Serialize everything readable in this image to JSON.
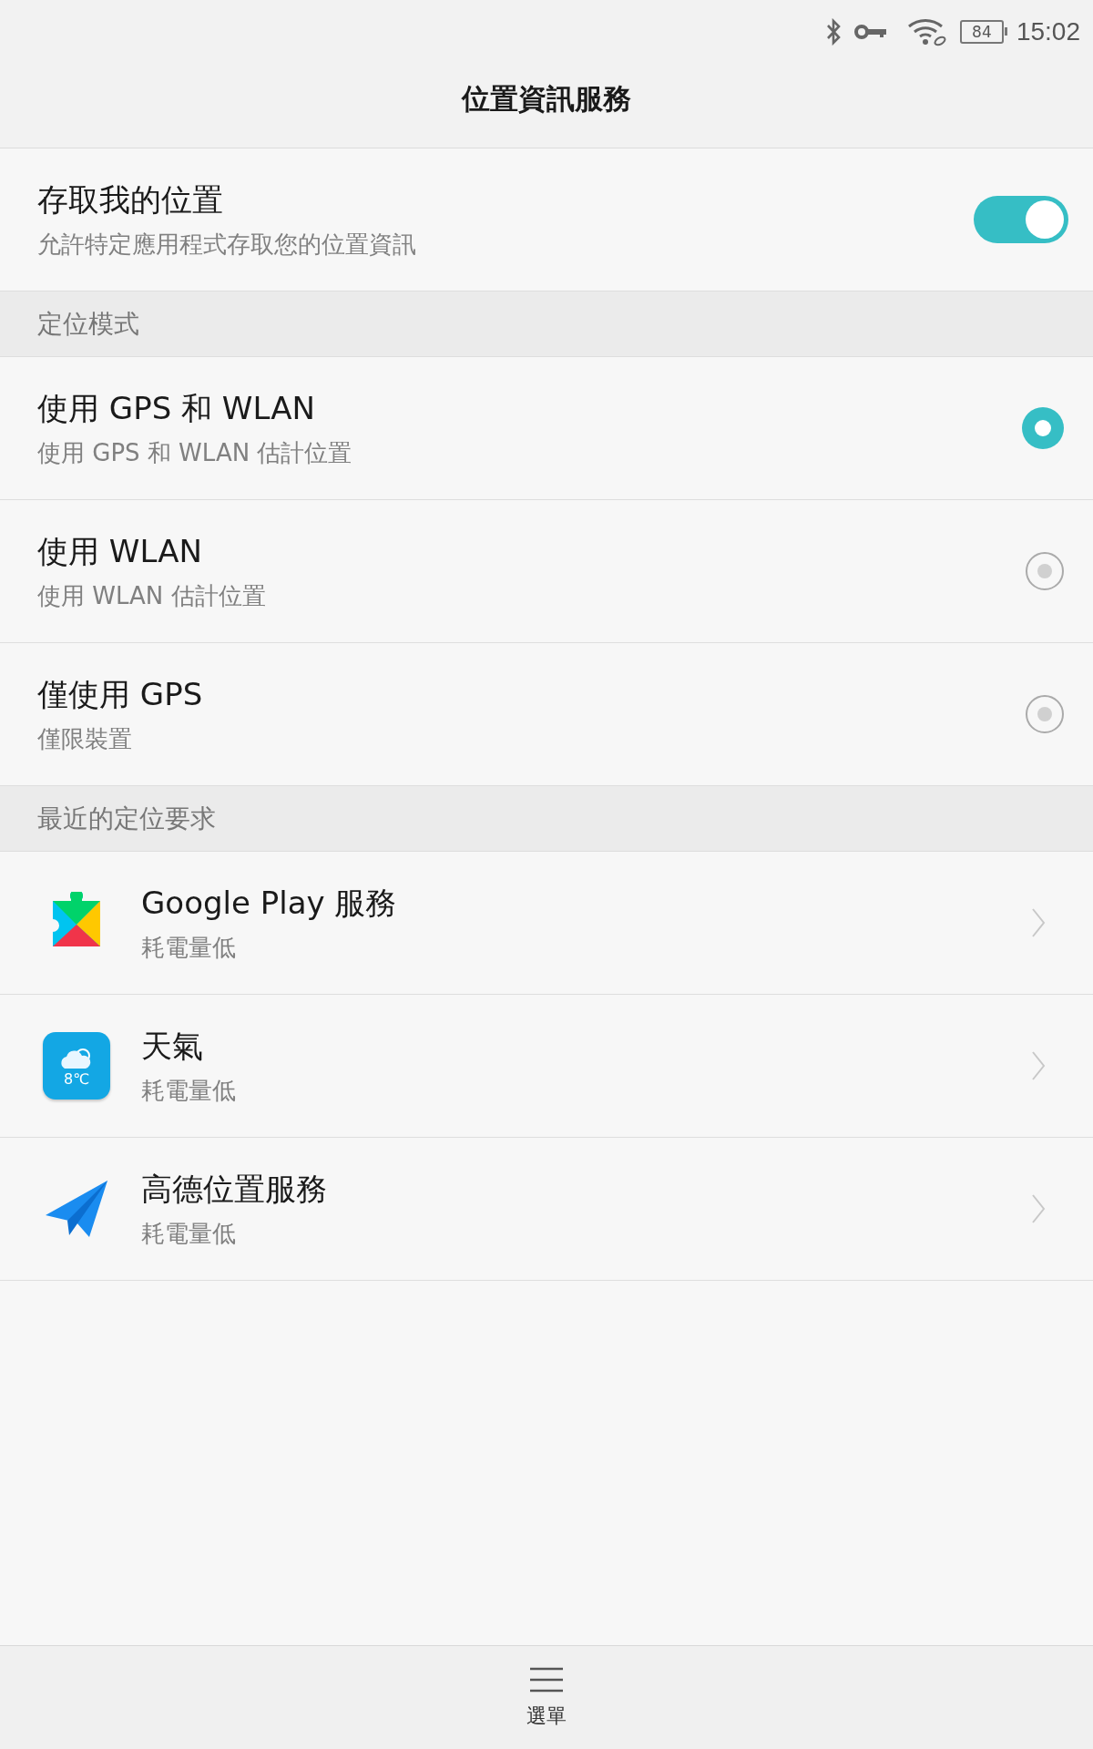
{
  "status_bar": {
    "battery": "84",
    "time": "15:02"
  },
  "title": "位置資訊服務",
  "access": {
    "title": "存取我的位置",
    "subtitle": "允許特定應用程式存取您的位置資訊",
    "on": true
  },
  "mode_section": {
    "header": "定位模式",
    "options": [
      {
        "title": "使用 GPS 和 WLAN",
        "subtitle": "使用 GPS 和 WLAN 估計位置",
        "selected": true
      },
      {
        "title": "使用 WLAN",
        "subtitle": "使用 WLAN 估計位置",
        "selected": false
      },
      {
        "title": "僅使用 GPS",
        "subtitle": "僅限裝置",
        "selected": false
      }
    ]
  },
  "recent_section": {
    "header": "最近的定位要求",
    "apps": [
      {
        "kind": "play-services",
        "name": "Google Play 服務",
        "usage": "耗電量低"
      },
      {
        "kind": "weather",
        "name": "天氣",
        "usage": "耗電量低",
        "icon_text": "8℃"
      },
      {
        "kind": "paper-plane",
        "name": "高德位置服務",
        "usage": "耗電量低"
      }
    ]
  },
  "bottom_bar": {
    "menu_label": "選單"
  }
}
